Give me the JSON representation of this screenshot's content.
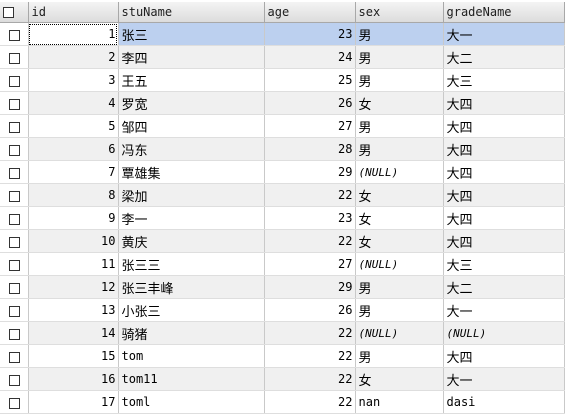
{
  "columns": [
    {
      "key": "id",
      "label": "id"
    },
    {
      "key": "stuName",
      "label": "stuName"
    },
    {
      "key": "age",
      "label": "age"
    },
    {
      "key": "sex",
      "label": "sex"
    },
    {
      "key": "gradeName",
      "label": "gradeName"
    }
  ],
  "null_text": "(NULL)",
  "rows": [
    {
      "id": "1",
      "stuName": "张三",
      "age": "23",
      "sex": "男",
      "gradeName": "大一"
    },
    {
      "id": "2",
      "stuName": "李四",
      "age": "24",
      "sex": "男",
      "gradeName": "大二"
    },
    {
      "id": "3",
      "stuName": "王五",
      "age": "25",
      "sex": "男",
      "gradeName": "大三"
    },
    {
      "id": "4",
      "stuName": "罗宽",
      "age": "26",
      "sex": "女",
      "gradeName": "大四"
    },
    {
      "id": "5",
      "stuName": "邹四",
      "age": "27",
      "sex": "男",
      "gradeName": "大四"
    },
    {
      "id": "6",
      "stuName": "冯东",
      "age": "28",
      "sex": "男",
      "gradeName": "大四"
    },
    {
      "id": "7",
      "stuName": "覃雄集",
      "age": "29",
      "sex": null,
      "gradeName": "大四"
    },
    {
      "id": "8",
      "stuName": "梁加",
      "age": "22",
      "sex": "女",
      "gradeName": "大四"
    },
    {
      "id": "9",
      "stuName": "李一",
      "age": "23",
      "sex": "女",
      "gradeName": "大四"
    },
    {
      "id": "10",
      "stuName": "黄庆",
      "age": "22",
      "sex": "女",
      "gradeName": "大四"
    },
    {
      "id": "11",
      "stuName": "张三三",
      "age": "27",
      "sex": null,
      "gradeName": "大三"
    },
    {
      "id": "12",
      "stuName": "张三丰峰",
      "age": "29",
      "sex": "男",
      "gradeName": "大二"
    },
    {
      "id": "13",
      "stuName": "小张三",
      "age": "26",
      "sex": "男",
      "gradeName": "大一"
    },
    {
      "id": "14",
      "stuName": "骑猪",
      "age": "22",
      "sex": null,
      "gradeName": null
    },
    {
      "id": "15",
      "stuName": "tom",
      "age": "22",
      "sex": "男",
      "gradeName": "大四"
    },
    {
      "id": "16",
      "stuName": "tom11",
      "age": "22",
      "sex": "女",
      "gradeName": "大一"
    },
    {
      "id": "17",
      "stuName": "toml",
      "age": "22",
      "sex": "nan",
      "gradeName": "dasi"
    }
  ],
  "selected_row_index": 0
}
